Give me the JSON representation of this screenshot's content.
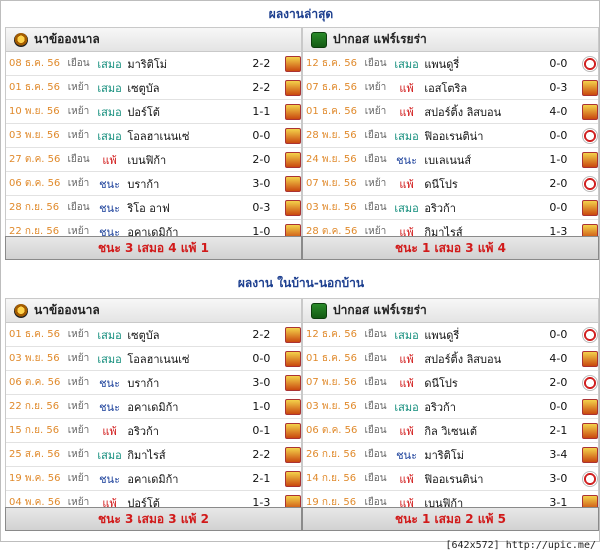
{
  "section1": {
    "title": "ผลงานล่าสุด",
    "left": {
      "team": "นาข้อองนาล",
      "matches": [
        {
          "date": "08 ธ.ค. 56",
          "venue": "เยือน",
          "result": "เสมอ",
          "opp": "มาริติโม่",
          "score": "2-2",
          "comp": "tpl"
        },
        {
          "date": "01 ธ.ค. 56",
          "venue": "เหย้า",
          "result": "เสมอ",
          "opp": "เซตูบัล",
          "score": "2-2",
          "comp": "tpl"
        },
        {
          "date": "10 พ.ย. 56",
          "venue": "เหย้า",
          "result": "เสมอ",
          "opp": "ปอร์โต้",
          "score": "1-1",
          "comp": "tpl"
        },
        {
          "date": "03 พ.ย. 56",
          "venue": "เหย้า",
          "result": "เสมอ",
          "opp": "โอลฮาเนนเซ่",
          "score": "0-0",
          "comp": "tpl"
        },
        {
          "date": "27 ต.ค. 56",
          "venue": "เยือน",
          "result": "แพ้",
          "opp": "เบนฟิก้า",
          "score": "2-0",
          "comp": "tpl"
        },
        {
          "date": "06 ต.ค. 56",
          "venue": "เหย้า",
          "result": "ชนะ",
          "opp": "บราก้า",
          "score": "3-0",
          "comp": "tpl"
        },
        {
          "date": "28 ก.ย. 56",
          "venue": "เยือน",
          "result": "ชนะ",
          "opp": "ริโอ อาฟ",
          "score": "0-3",
          "comp": "tpl"
        },
        {
          "date": "22 ก.ย. 56",
          "venue": "เหย้า",
          "result": "ชนะ",
          "opp": "อคาเดมิก้า",
          "score": "1-0",
          "comp": "tpl"
        }
      ],
      "summary": "ชนะ 3 เสมอ 4 แพ้ 1"
    },
    "right": {
      "team": "ปากอส แฟร์เรยร่า",
      "matches": [
        {
          "date": "12 ธ.ค. 56",
          "venue": "เยือน",
          "result": "เสมอ",
          "opp": "แพนดูรี่",
          "score": "0-0",
          "comp": "ucl"
        },
        {
          "date": "07 ธ.ค. 56",
          "venue": "เหย้า",
          "result": "แพ้",
          "opp": "เอสโตริล",
          "score": "0-3",
          "comp": "tpl"
        },
        {
          "date": "01 ธ.ค. 56",
          "venue": "เหย้า",
          "result": "แพ้",
          "opp": "สปอร์ติ้ง ลิสบอน",
          "score": "4-0",
          "comp": "tpl"
        },
        {
          "date": "28 พ.ย. 56",
          "venue": "เยือน",
          "result": "เสมอ",
          "opp": "ฟิออเรนติน่า",
          "score": "0-0",
          "comp": "ucl"
        },
        {
          "date": "24 พ.ย. 56",
          "venue": "เยือน",
          "result": "ชนะ",
          "opp": "เบเลเนนส์",
          "score": "1-0",
          "comp": "tpl"
        },
        {
          "date": "07 พ.ย. 56",
          "venue": "เหย้า",
          "result": "แพ้",
          "opp": "ดนีโปร",
          "score": "2-0",
          "comp": "ucl"
        },
        {
          "date": "03 พ.ย. 56",
          "venue": "เยือน",
          "result": "เสมอ",
          "opp": "อริวก้า",
          "score": "0-0",
          "comp": "tpl"
        },
        {
          "date": "28 ต.ค. 56",
          "venue": "เหย้า",
          "result": "แพ้",
          "opp": "กิมาไรส์",
          "score": "1-3",
          "comp": "tpl"
        }
      ],
      "summary": "ชนะ 1 เสมอ 3 แพ้ 4"
    }
  },
  "section2": {
    "title": "ผลงาน ในบ้าน-นอกบ้าน",
    "left": {
      "team": "นาข้อองนาล",
      "matches": [
        {
          "date": "01 ธ.ค. 56",
          "venue": "เหย้า",
          "result": "เสมอ",
          "opp": "เซตูบัล",
          "score": "2-2",
          "comp": "tpl"
        },
        {
          "date": "03 พ.ย. 56",
          "venue": "เหย้า",
          "result": "เสมอ",
          "opp": "โอลฮาเนนเซ่",
          "score": "0-0",
          "comp": "tpl"
        },
        {
          "date": "06 ต.ค. 56",
          "venue": "เหย้า",
          "result": "ชนะ",
          "opp": "บราก้า",
          "score": "3-0",
          "comp": "tpl"
        },
        {
          "date": "22 ก.ย. 56",
          "venue": "เหย้า",
          "result": "ชนะ",
          "opp": "อคาเดมิก้า",
          "score": "1-0",
          "comp": "tpl"
        },
        {
          "date": "15 ก.ย. 56",
          "venue": "เหย้า",
          "result": "แพ้",
          "opp": "อริวก้า",
          "score": "0-1",
          "comp": "tpl"
        },
        {
          "date": "25 ส.ค. 56",
          "venue": "เหย้า",
          "result": "เสมอ",
          "opp": "กิมาไรส์",
          "score": "2-2",
          "comp": "tpl"
        },
        {
          "date": "19 พ.ค. 56",
          "venue": "เหย้า",
          "result": "ชนะ",
          "opp": "อคาเดมิก้า",
          "score": "2-1",
          "comp": "tpl"
        },
        {
          "date": "04 พ.ค. 56",
          "venue": "เหย้า",
          "result": "แพ้",
          "opp": "ปอร์โต้",
          "score": "1-3",
          "comp": "tpl"
        }
      ],
      "summary": "ชนะ 3 เสมอ 3 แพ้ 2"
    },
    "right": {
      "team": "ปากอส แฟร์เรยร่า",
      "matches": [
        {
          "date": "12 ธ.ค. 56",
          "venue": "เยือน",
          "result": "เสมอ",
          "opp": "แพนดูรี่",
          "score": "0-0",
          "comp": "ucl"
        },
        {
          "date": "01 ธ.ค. 56",
          "venue": "เยือน",
          "result": "แพ้",
          "opp": "สปอร์ติ้ง ลิสบอน",
          "score": "4-0",
          "comp": "tpl"
        },
        {
          "date": "07 พ.ย. 56",
          "venue": "เยือน",
          "result": "แพ้",
          "opp": "ดนีโปร",
          "score": "2-0",
          "comp": "ucl"
        },
        {
          "date": "03 พ.ย. 56",
          "venue": "เยือน",
          "result": "เสมอ",
          "opp": "อริวก้า",
          "score": "0-0",
          "comp": "tpl"
        },
        {
          "date": "06 ต.ค. 56",
          "venue": "เยือน",
          "result": "แพ้",
          "opp": "กิล วิเซนเต้",
          "score": "2-1",
          "comp": "tpl"
        },
        {
          "date": "26 ก.ย. 56",
          "venue": "เยือน",
          "result": "ชนะ",
          "opp": "มาริติโม่",
          "score": "3-4",
          "comp": "tpl"
        },
        {
          "date": "14 ก.ย. 56",
          "venue": "เยือน",
          "result": "แพ้",
          "opp": "ฟิออเรนติน่า",
          "score": "3-0",
          "comp": "ucl"
        },
        {
          "date": "19 ก.ย. 56",
          "venue": "เยือน",
          "result": "แพ้",
          "opp": "เบนฟิก้า",
          "score": "3-1",
          "comp": "tpl"
        }
      ],
      "summary": "ชนะ 1 เสมอ 2 แพ้ 5"
    }
  },
  "footer": "[642x572] http://upic.me/"
}
